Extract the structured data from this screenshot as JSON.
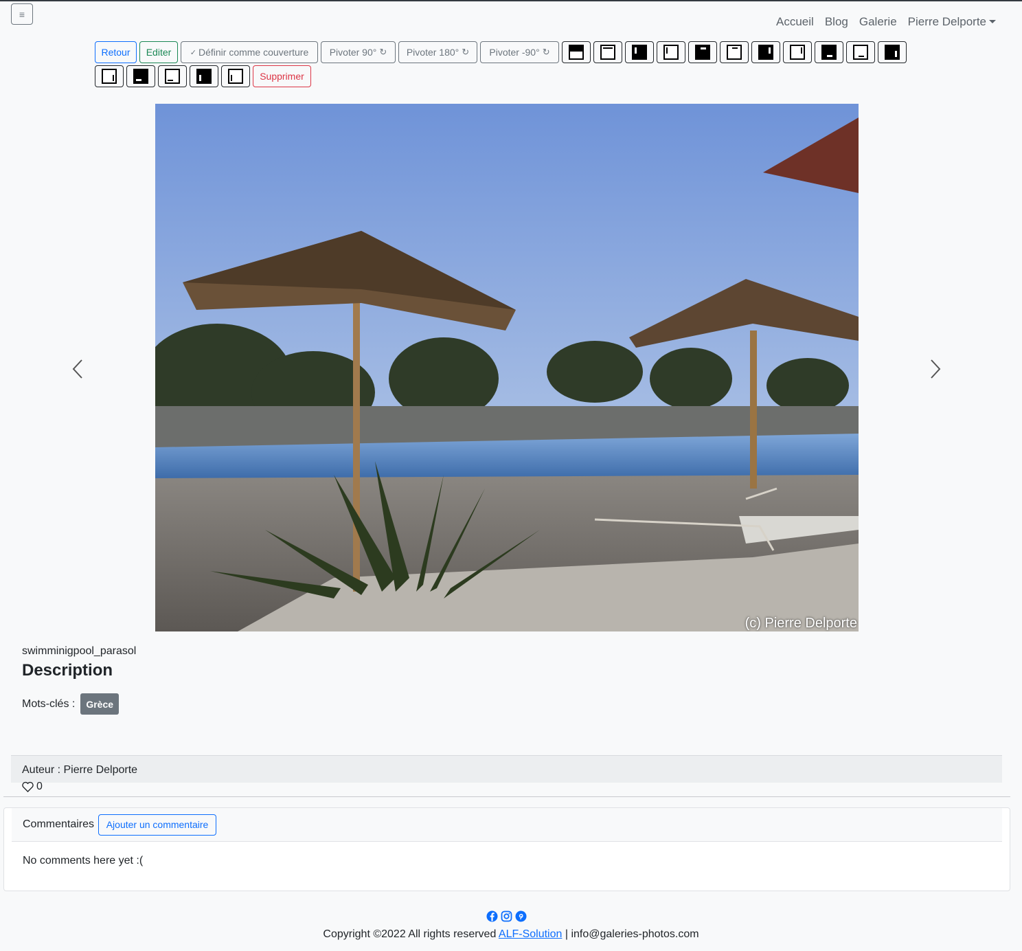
{
  "nav": {
    "menu_icon": "hamburger-icon",
    "links": [
      "Accueil",
      "Blog",
      "Galerie"
    ],
    "user": "Pierre Delporte"
  },
  "toolbar": {
    "back": "Retour",
    "edit": "Editer",
    "set_cover": "Définir comme couverture",
    "rotate_90": "Pivoter 90°",
    "rotate_180": "Pivoter 180°",
    "rotate_minus_90": "Pivoter -90°",
    "delete": "Supprimer",
    "position_icons": [
      "top-filled",
      "top-outline",
      "left-filled",
      "left-outline",
      "top-center-filled",
      "top-center-outline",
      "right-filled",
      "right-outline",
      "bottom-filled",
      "bottom-outline",
      "right-full-filled",
      "right-full-outline",
      "bottom-center-filled",
      "bottom-center-outline",
      "left-full-filled",
      "left-full-outline"
    ]
  },
  "photo": {
    "watermark": "(c) Pierre Delporte"
  },
  "details": {
    "filename": "swimminigpool_parasol",
    "description_heading": "Description",
    "keywords_label": "Mots-clés :",
    "keywords": [
      "Grèce"
    ]
  },
  "author": {
    "label": "Auteur : Pierre Delporte",
    "likes": "0"
  },
  "comments": {
    "title": "Commentaires",
    "add_button": "Ajouter un commentaire",
    "empty": "No comments here yet :("
  },
  "footer": {
    "copyright": "Copyright ©2022 All rights reserved",
    "company": "ALF-Solution",
    "email": "| info@galeries-photos.com",
    "social_icons": [
      "facebook-icon",
      "instagram-icon",
      "pinterest-icon"
    ]
  }
}
